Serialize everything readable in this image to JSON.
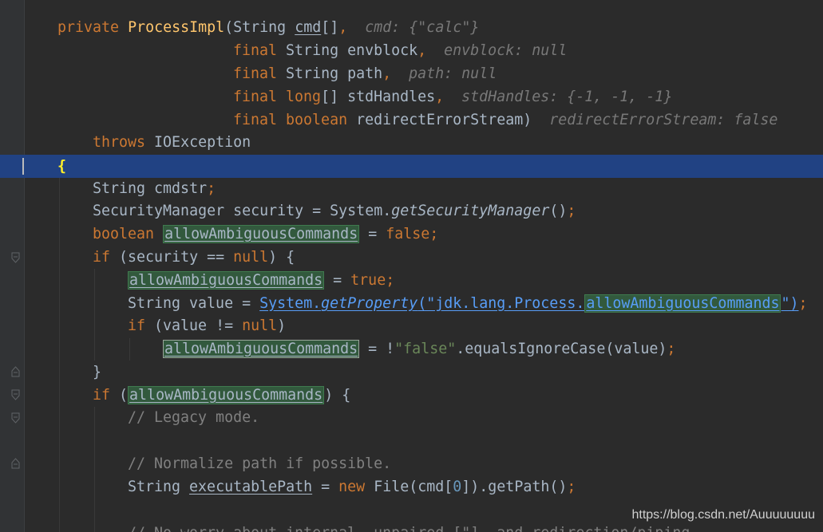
{
  "editor": {
    "hints": {
      "cmd": "cmd: {\"calc\"}",
      "envblock": "envblock: null",
      "path": "path: null",
      "stdHandles": "stdHandles: {-1, -1, -1}",
      "redirectErrorStream": "redirectErrorStream: false"
    },
    "comments": {
      "legacy": "// Legacy mode.",
      "normalize": "// Normalize path if possible.",
      "noworry": "// No worry about internal, unpaired [\"], and redirection/piping."
    }
  },
  "watermark": "https://blog.csdn.net/Auuuuuuuu",
  "colors": {
    "background": "#2b2b2b",
    "current_line": "#214283",
    "keyword": "#cc7832",
    "method": "#ffc66d",
    "string": "#6a8759",
    "number": "#6897bb",
    "highlight": "#32593d"
  }
}
